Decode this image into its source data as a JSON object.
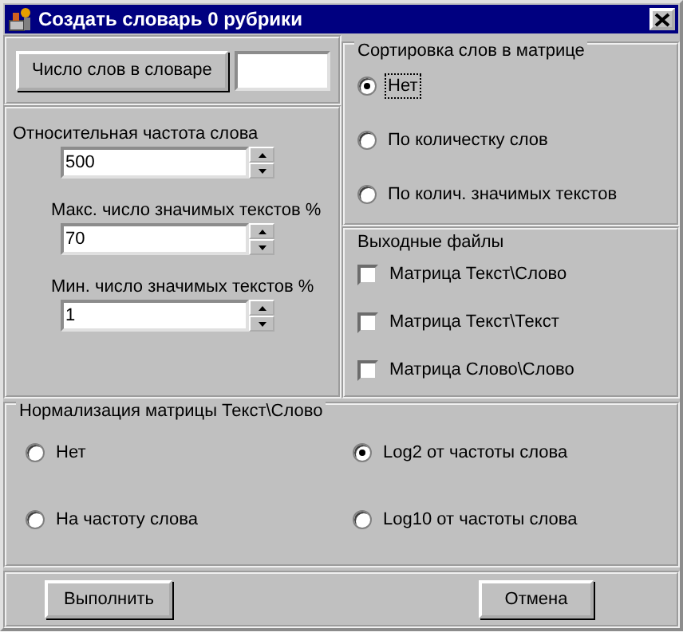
{
  "window": {
    "title": "Создать словарь 0 рубрики"
  },
  "word_count": {
    "button": "Число слов в словаре"
  },
  "spinners": [
    {
      "label": "Относительная частота слова",
      "value": "500"
    },
    {
      "label": "Макс. число значимых текстов %",
      "value": "70"
    },
    {
      "label": "Мин. число значимых текстов %",
      "value": "1"
    }
  ],
  "sorting": {
    "title": "Сортировка слов в матрице",
    "options": [
      {
        "label": "Нет",
        "selected": true,
        "focused": true
      },
      {
        "label": "По количестку слов",
        "selected": false,
        "focused": false
      },
      {
        "label": "По колич. значимых текстов",
        "selected": false,
        "focused": false
      }
    ]
  },
  "output_files": {
    "title": "Выходные файлы",
    "items": [
      {
        "label": "Матрица Текст\\Слово",
        "checked": false
      },
      {
        "label": "Матрица Текст\\Текст",
        "checked": false
      },
      {
        "label": "Матрица Слово\\Слово",
        "checked": false
      }
    ]
  },
  "normalization": {
    "title": "Нормализация матрицы Текст\\Слово",
    "options": [
      {
        "label": "Нет",
        "selected": false
      },
      {
        "label": "Log2 от частоты слова",
        "selected": true
      },
      {
        "label": "На частоту слова",
        "selected": false
      },
      {
        "label": "Log10 от частоты слова",
        "selected": false
      }
    ]
  },
  "buttons": [
    "Выполнить",
    "Отмена"
  ]
}
